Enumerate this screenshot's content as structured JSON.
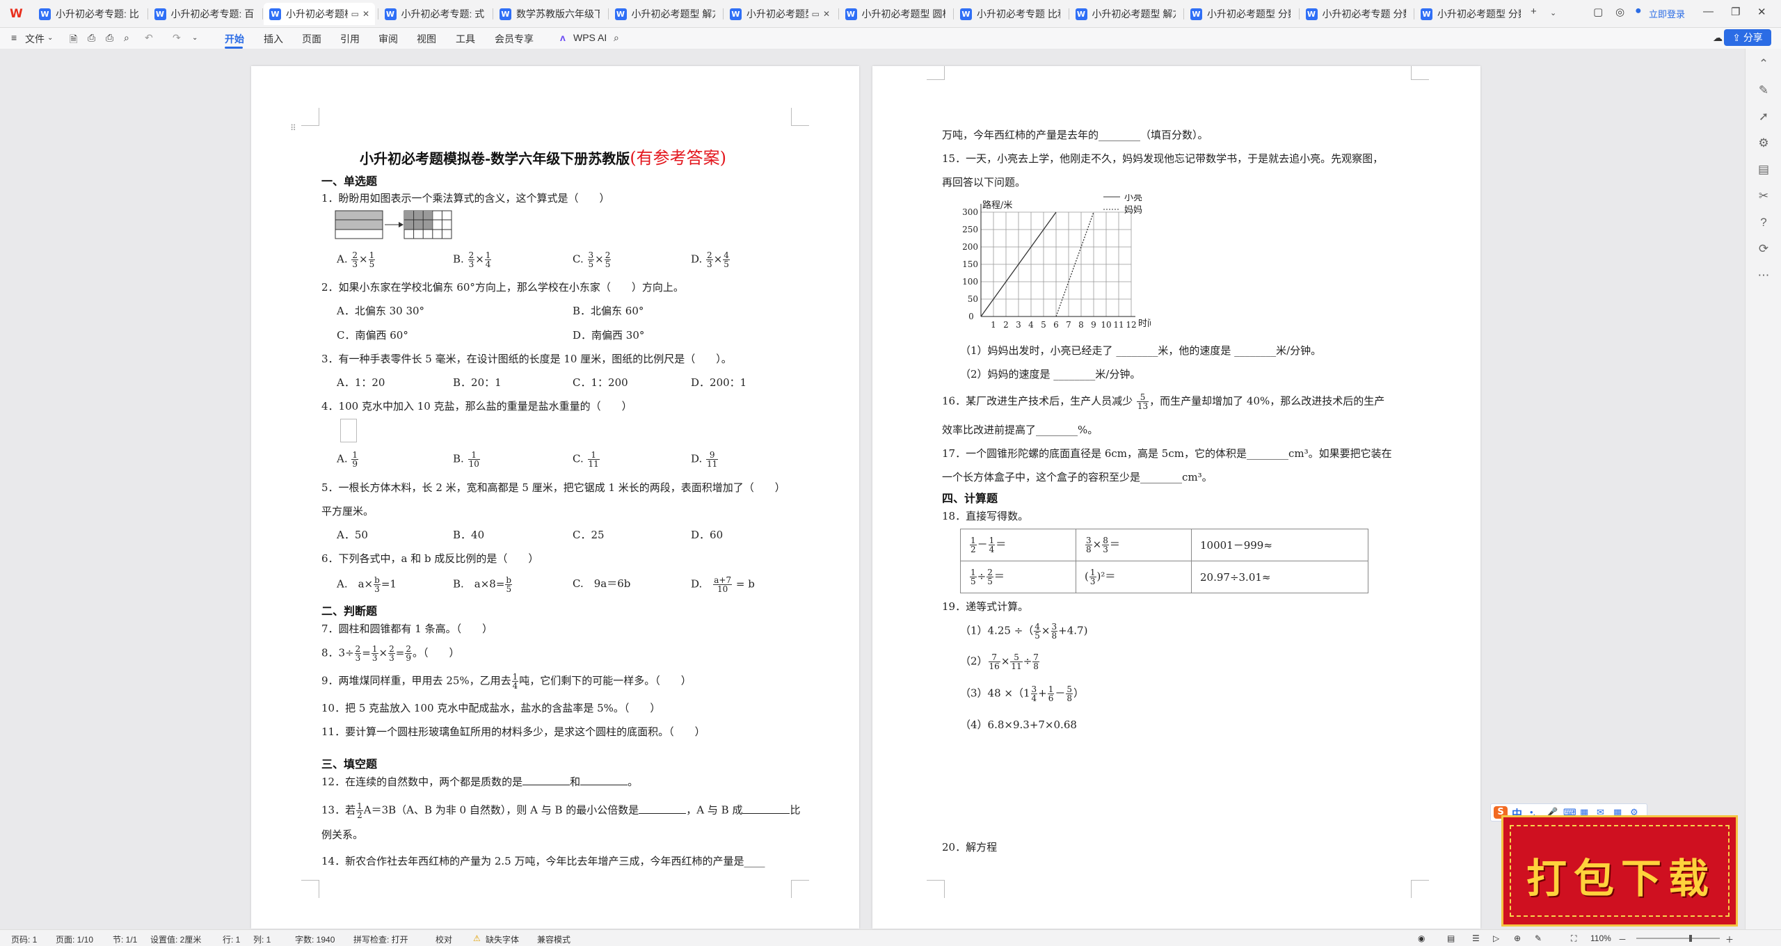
{
  "tabs": [
    {
      "label": "小升初必考专题: 比和比例"
    },
    {
      "label": "小升初必考专题: 百分数"
    },
    {
      "label": "小升初必考题模拟卷"
    },
    {
      "label": "小升初必考专题: 式与方程"
    },
    {
      "label": "数学苏教版六年级下册"
    },
    {
      "label": "小升初必考题型 解方程"
    },
    {
      "label": "小升初必考题型 平面"
    },
    {
      "label": "小升初必考题型 圆柱和圆锥"
    },
    {
      "label": "小升初必考专题 比和比例"
    },
    {
      "label": "小升初必考题型 解方程"
    },
    {
      "label": "小升初必考题型 分数"
    },
    {
      "label": "小升初必考专题 分数"
    },
    {
      "label": "小升初必考题型 分数"
    }
  ],
  "titlebar": {
    "login": "立即登录",
    "new_tab": "+"
  },
  "ribbon": {
    "file": "文件",
    "tabs": [
      "开始",
      "插入",
      "页面",
      "引用",
      "审阅",
      "视图",
      "工具",
      "会员专享"
    ],
    "wps_ai": "WPS AI",
    "share": "分享"
  },
  "page1": {
    "title": "小升初必考题模拟卷-数学六年级下册苏教版",
    "title_red": "(有参考答案)",
    "sec1": "一、单选题",
    "q1": "1．盼盼用如图表示一个乘法算式的含义，这个算式是（　　）",
    "q1_opts": [
      "A.",
      "B.",
      "C.",
      "D."
    ],
    "q2": "2．如果小东家在学校北偏东 60°方向上，那么学校在小东家（　　）方向上。",
    "q2_a": "A．北偏东 30 30°",
    "q2_b": "B．北偏东 60°",
    "q2_c": "C．南偏西 60°",
    "q2_d": "D．南偏西 30°",
    "q3": "3．有一种手表零件长 5 毫米，在设计图纸的长度是 10 厘米，图纸的比例尺是（　　）。",
    "q3_opts": [
      "A．1：20",
      "B．20：1",
      "C．1：200",
      "D．200：1"
    ],
    "q4": "4．100 克水中加入 10 克盐，那么盐的重量是盐水重量的（　　）",
    "q4_opts": [
      "A.",
      "B.",
      "C.",
      "D."
    ],
    "q5": "5．一根长方体木料，长 2 米，宽和高都是 5 厘米，把它锯成 1 米长的两段，表面积增加了（　　）",
    "q5b": "平方厘米。",
    "q5_opts": [
      "A．50",
      "B．40",
      "C．25",
      "D．60"
    ],
    "q6": "6．下列各式中，a 和 b 成反比例的是（　　）",
    "sec2": "二、判断题",
    "q7": "7．圆柱和圆锥都有 1 条高。（　　）",
    "q9": "9．两堆煤同样重，甲用去 25%，乙用去",
    "q9b": "吨，它们剩下的可能一样多。（　　）",
    "q10": "10．把 5 克盐放入 100 克水中配成盐水，盐水的含盐率是 5%。（　　）",
    "q11": "11．要计算一个圆柱形玻璃鱼缸所用的材料多少，是求这个圆柱的底面积。（　　）",
    "sec3": "三、填空题",
    "q12": "12．在连续的自然数中，两个都是质数的是",
    "q12b": "和",
    "q13": "13．若",
    "q13b": "A＝3B（A、B 为非 0 自然数），则 A 与 B 的最小公倍数是",
    "q13c": "，A 与 B 成",
    "q13d": "比",
    "q13e": "例关系。",
    "q14": "14．新农合作社去年西红柿的产量为 2.5 万吨，今年比去年增产三成，今年西红柿的产量是____"
  },
  "page2": {
    "l1": "万吨，今年西红柿的产量是去年的________（填百分数）。",
    "q15": "15．一天，小亮去上学，他刚走不久，妈妈发现他忘记带数学书，于是就去追小亮。先观察图，",
    "q15b": "再回答以下问题。",
    "q15_1": "（1）妈妈出发时，小亮已经走了 ________米，他的速度是 ________米/分钟。",
    "q15_2": "（2）妈妈的速度是 ________米/分钟。",
    "q16": "16．某厂改进生产技术后，生产人员减少",
    "q16b": "，而生产量却增加了 40%，那么改进技术后的生产",
    "q16c": "效率比改进前提高了________%。",
    "q17": "17．一个圆锥形陀螺的底面直径是 6cm，高是 5cm，它的体积是________cm³。如果要把它装在",
    "q17b": "一个长方体盒子中，这个盒子的容积至少是________cm³。",
    "sec4": "四、计算题",
    "q18": "18．直接写得数。",
    "calc_r1c3": "10001－999≈",
    "calc_r2c3": "20.97÷3.01≈",
    "q19": "19．递等式计算。",
    "q19_1": "（1）4.25 ÷（",
    "q19_4": "（4）6.8×9.3+7×0.68",
    "q20": "20．解方程"
  },
  "chart_data": {
    "type": "line",
    "xlabel": "时间/分钟",
    "ylabel": "路程/米",
    "x_ticks": [
      "1",
      "2",
      "3",
      "4",
      "5",
      "6",
      "7",
      "8",
      "9",
      "10",
      "11",
      "12"
    ],
    "y_ticks": [
      "0",
      "50",
      "100",
      "150",
      "200",
      "250",
      "300"
    ],
    "origin_label": "0",
    "xlim": [
      0,
      12
    ],
    "ylim": [
      0,
      300
    ],
    "series": [
      {
        "name": "小亮",
        "style": "solid",
        "points": [
          [
            0,
            0
          ],
          [
            6,
            300
          ]
        ]
      },
      {
        "name": "妈妈",
        "style": "dotted",
        "points": [
          [
            6,
            0
          ],
          [
            9,
            300
          ]
        ]
      }
    ],
    "grid": true,
    "legend": "top-right"
  },
  "ime": {
    "logo": "S",
    "mode": "中"
  },
  "badge": {
    "text": "打包下载"
  },
  "status": {
    "page": "页码: 1",
    "pages": "页面: 1/10",
    "section": "节: 1/1",
    "setting": "设置值: 2厘米",
    "row": "行: 1",
    "col": "列: 1",
    "words": "字数: 1940",
    "spell": "拼写检查: 打开",
    "proof": "校对",
    "missing_font": "缺失字体",
    "compat": "兼容模式",
    "zoom": "110%"
  },
  "colors": {
    "accent": "#2b6ce5",
    "title_red": "#e3161d",
    "badge_red": "#cf1020",
    "badge_gold": "#ffd23c"
  }
}
